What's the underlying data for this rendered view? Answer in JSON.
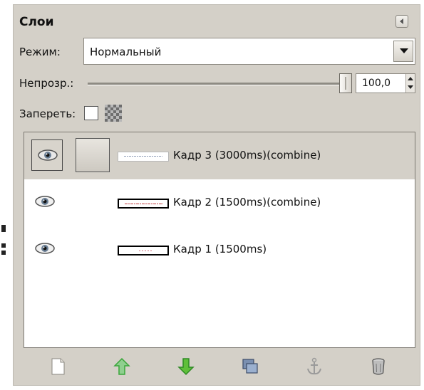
{
  "panel": {
    "title": "Слои"
  },
  "mode": {
    "label": "Режим:",
    "value": "Нормальный"
  },
  "opacity": {
    "label": "Непрозр.:",
    "value": "100,0",
    "level_percent": 100
  },
  "lock": {
    "label": "Запереть:",
    "checked": false
  },
  "layers": [
    {
      "label": "Кадр 3 (3000ms)(combine)",
      "selected": true,
      "visible": true
    },
    {
      "label": "Кадр 2 (1500ms)(combine)",
      "selected": false,
      "visible": true
    },
    {
      "label": "Кадр 1 (1500ms)",
      "selected": false,
      "visible": true
    }
  ],
  "toolbar": {
    "buttons": [
      {
        "icon": "new-layer-icon"
      },
      {
        "icon": "raise-layer-icon"
      },
      {
        "icon": "lower-layer-icon"
      },
      {
        "icon": "duplicate-layer-icon"
      },
      {
        "icon": "anchor-layer-icon"
      },
      {
        "icon": "delete-layer-icon"
      }
    ]
  },
  "colors": {
    "panel_bg": "#d4d0c8",
    "selected_row": "#d4d0c8",
    "arrow_green": "#3aa63a"
  }
}
